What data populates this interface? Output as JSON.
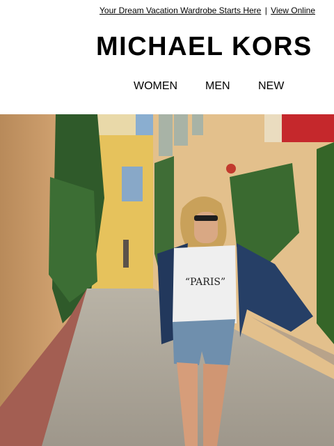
{
  "preheader": {
    "tagline_link": "Your Dream Vacation Wardrobe Starts Here",
    "separator": "|",
    "view_online_link": "View Online"
  },
  "brand": {
    "logo_text": "MICHAEL KORS"
  },
  "nav": {
    "items": [
      "WOMEN",
      "MEN",
      "NEW"
    ]
  },
  "hero": {
    "shirt_print": "“PARIS”"
  }
}
